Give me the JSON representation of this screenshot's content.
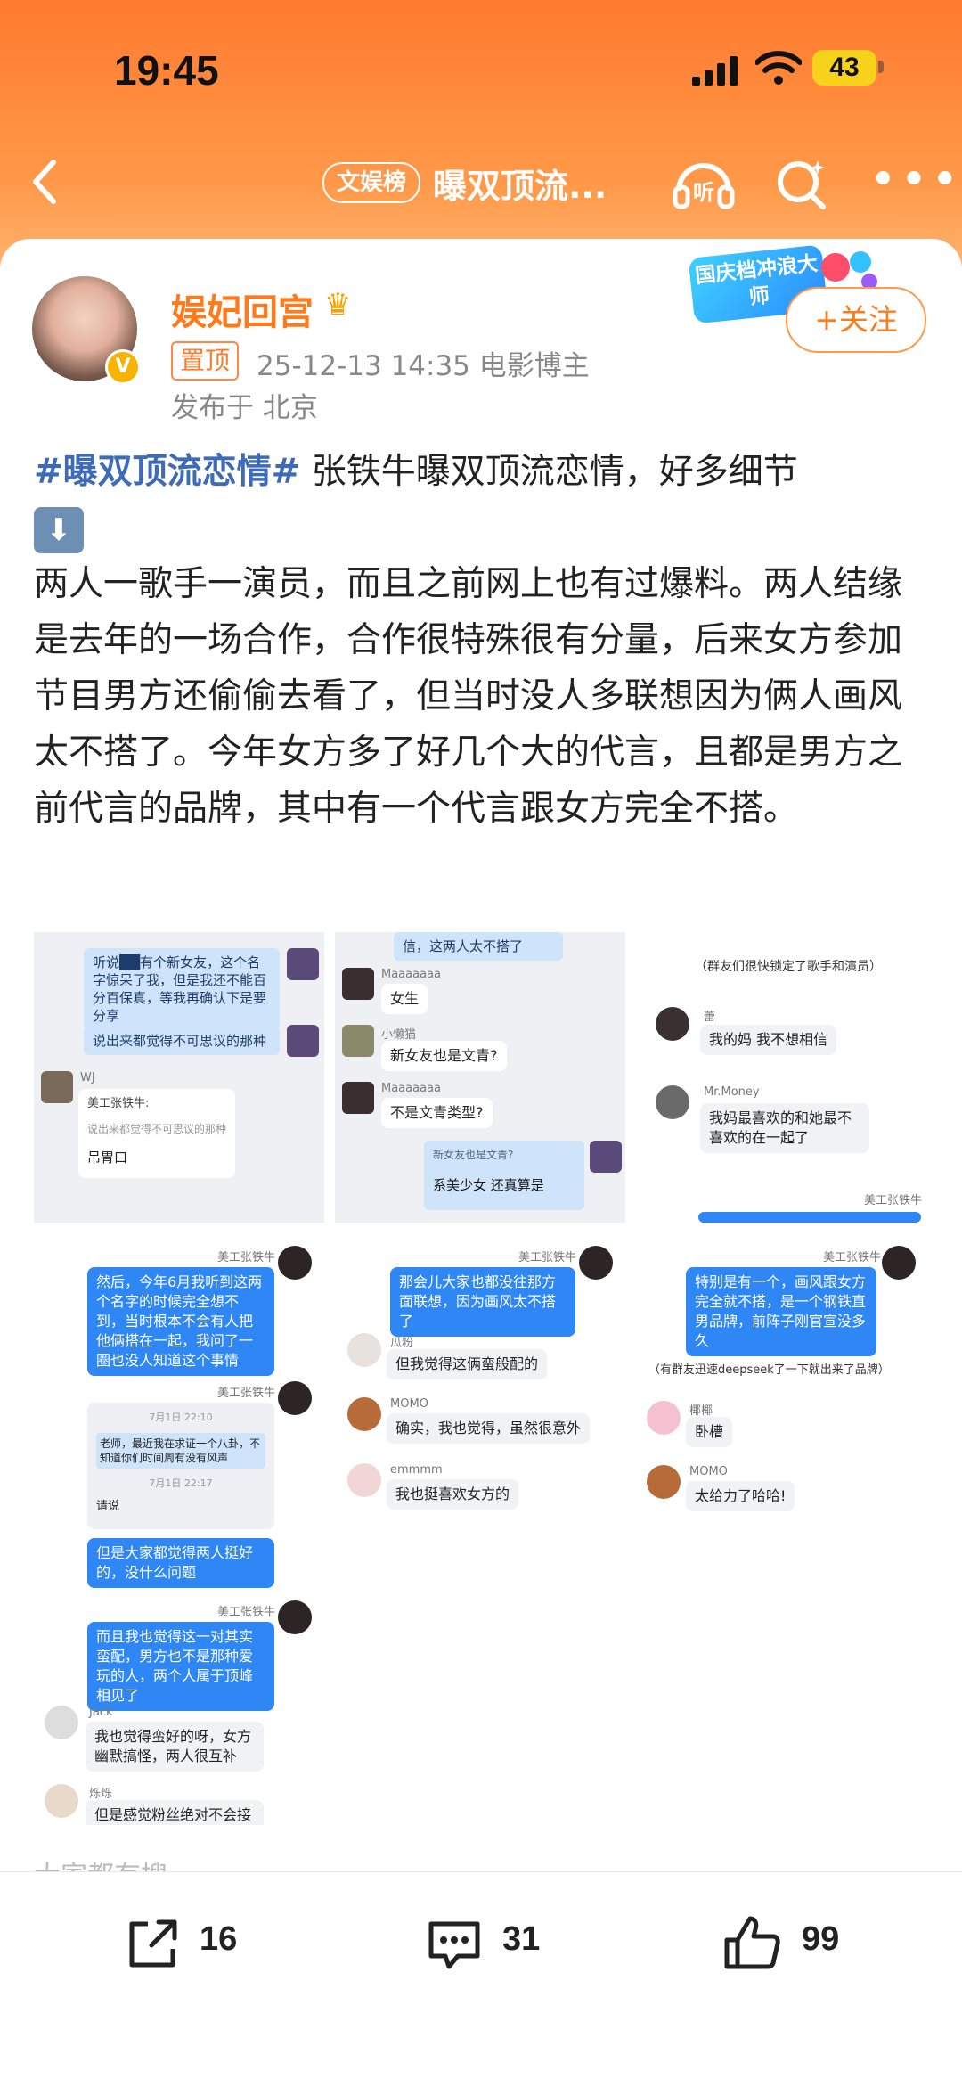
{
  "status_bar": {
    "time": "19:45",
    "battery": "43"
  },
  "navbar": {
    "tag": "文娱榜",
    "title": "曝双顶流...",
    "listen_label": "听"
  },
  "author": {
    "name": "娱妃回宫",
    "pinned_label": "置顶",
    "meta": "25-12-13 14:35  电影博主",
    "location": "发布于 北京",
    "follow_label": "+关注",
    "promo": "国庆档冲浪大师"
  },
  "post": {
    "hashtag": "#曝双顶流恋情#",
    "line1": " 张铁牛曝双顶流恋情，好多细节",
    "arrow": "⬇",
    "body": "两人一歌手一演员，而且之前网上也有过爆料。两人结缘是去年的一场合作，合作很特殊很有分量，后来女方参加节目男方还偷偷去看了，但当时没人多联想因为俩人画风太不搭了。今年女方多了好几个大的代言，且都是男方之前代言的品牌，其中有一个代言跟女方完全不搭。"
  },
  "screenshots": {
    "s1": {
      "b1": "听说██有个新女友，这个名字惊呆了我，但是我还不能百分百保真，等我再确认下是要分享",
      "b2": "说出来都觉得不可思议的那种",
      "name": "WJ",
      "quote_title": "美工张铁牛:",
      "quote_body": "说出来都觉得不可思议的那种",
      "reply": "吊胃口"
    },
    "s2": {
      "b0": "信，这两人太不搭了",
      "n1": "Maaaaaaa",
      "r1": "女生",
      "n2": "小懒猫",
      "r2": "新女友也是文青?",
      "n3": "Maaaaaaa",
      "r3": "不是文青类型?",
      "quote": "新女友也是文青?",
      "b_last": "系美少女 还真算是"
    },
    "s3": {
      "sys": "（群友们很快锁定了歌手和演员）",
      "n1": "蕾",
      "r1": "我的妈 我不想相信",
      "n2": "Mr.Money",
      "r2": "我妈最喜欢的和她最不喜欢的在一起了",
      "n3": "美工张铁牛"
    },
    "s4": {
      "n": "美工张铁牛",
      "b1": "然后，今年6月我听到这两个名字的时候完全想不到，当时根本不会有人把他俩搭在一起，我问了一圈也没人知道这个事情",
      "n2": "美工张铁牛",
      "t1": "7月1日 22:10",
      "note": "老师，最近我在求证一个八卦，不知道你们时间周有没有风声",
      "t2": "7月1日 22:17",
      "tail": "请说"
    },
    "s5": {
      "n": "美工张铁牛",
      "b1": "那会儿大家也都没往那方面联想，因为画风太不搭了",
      "n1": "瓜粉",
      "r1": "但我觉得这俩蛮般配的",
      "n2": "MOMO",
      "r2": "确实，我也觉得，虽然很意外",
      "n3": "emmmm",
      "r3": "我也挺喜欢女方的"
    },
    "s6": {
      "n": "美工张铁牛",
      "b1": "特别是有一个，画风跟女方完全就不搭，是一个钢铁直男品牌，前阵子刚官宣没多久",
      "sys": "（有群友迅速deepseek了一下就出来了品牌）",
      "n1": "椰椰",
      "r1": "卧槽",
      "n2": "MOMO",
      "r2": "太给力了哈哈!"
    },
    "s7": {
      "b0": "但是大家都觉得两人挺好的，没什么问题",
      "n": "美工张铁牛",
      "b1": "而且我也觉得这一对其实蛮配，男方也不是那种爱玩的人，两个人属于顶峰相见了",
      "n1": "Jack",
      "r1": "我也觉得蛮好的呀，女方幽默搞怪，两人很互补",
      "n2": "烁烁",
      "r2": "但是感觉粉丝绝对不会接受,"
    }
  },
  "peek_text": "大家都有搜",
  "actions": {
    "share": "16",
    "comment": "31",
    "like": "99"
  },
  "colors": {
    "accent": "#ff7a1a",
    "hashtag": "#3d6bb6",
    "bubble": "#2f87f5"
  }
}
